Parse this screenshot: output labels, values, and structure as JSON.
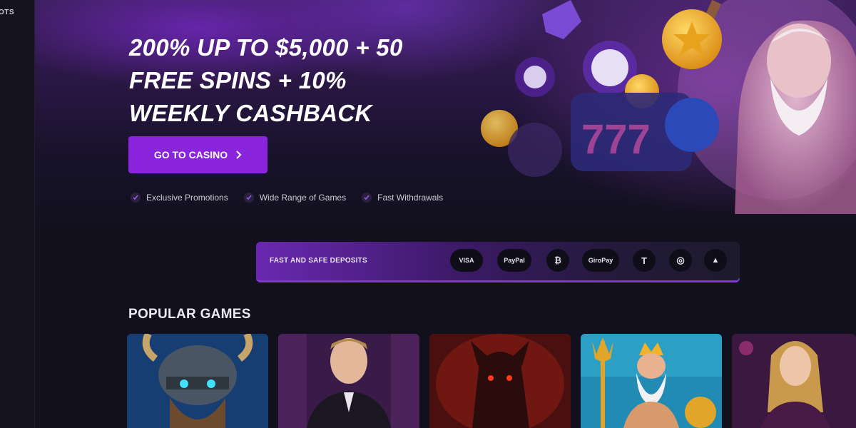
{
  "sidebar": {
    "label": "OTS"
  },
  "hero": {
    "headline": "200% UP TO $5,000 + 50\nFREE SPINS + 10%\nWEEKLY CASHBACK",
    "cta_label": "GO TO CASINO",
    "cta_icon": "chevron-right-icon",
    "features": [
      "Exclusive Promotions",
      "Wide Range of Games",
      "Fast Withdrawals"
    ]
  },
  "deposits": {
    "label": "FAST AND SAFE DEPOSITS",
    "methods": [
      "VISA",
      "PayPal",
      "₿",
      "GiroPay",
      "T",
      "◎",
      "▲"
    ]
  },
  "popular_games": {
    "title": "POPULAR GAMES",
    "tiles": [
      "viking-warrior",
      "male-dealer",
      "hellhound",
      "poseidon",
      "female-dealer"
    ]
  },
  "colors": {
    "accent": "#8a25dd",
    "background": "#12101d",
    "gold": "#f2b22a"
  }
}
